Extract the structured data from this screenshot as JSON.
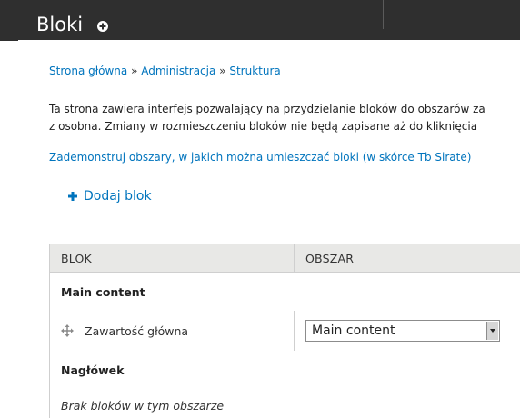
{
  "header": {
    "title": "Bloki",
    "shortcut_icon": "plus-circle-icon"
  },
  "breadcrumb": {
    "items": [
      "Strona główna",
      "Administracja",
      "Struktura"
    ],
    "separator": "»"
  },
  "help": {
    "line1": "Ta strona zawiera interfejs pozwalający na przydzielanie bloków do obszarów za",
    "line2": "z osobna. Zmiany w rozmieszczeniu bloków nie będą zapisane aż do kliknięcia"
  },
  "demo_link": "Zademonstruj obszary, w jakich można umieszczać bloki (w skórce Tb Sirate)",
  "actions": {
    "add_block": "Dodaj blok",
    "add_icon": "plus-icon"
  },
  "table": {
    "headers": [
      "BLOK",
      "OBSZAR"
    ],
    "regions": [
      {
        "name": "Main content",
        "blocks": [
          {
            "label": "Zawartość główna",
            "region": "Main content"
          }
        ]
      },
      {
        "name": "Nagłówek",
        "empty_text": "Brak bloków w tym obszarze"
      }
    ]
  },
  "colors": {
    "header_bg": "#2f2f2f",
    "link": "#0074bd",
    "table_header_bg": "#e8e8e6"
  }
}
